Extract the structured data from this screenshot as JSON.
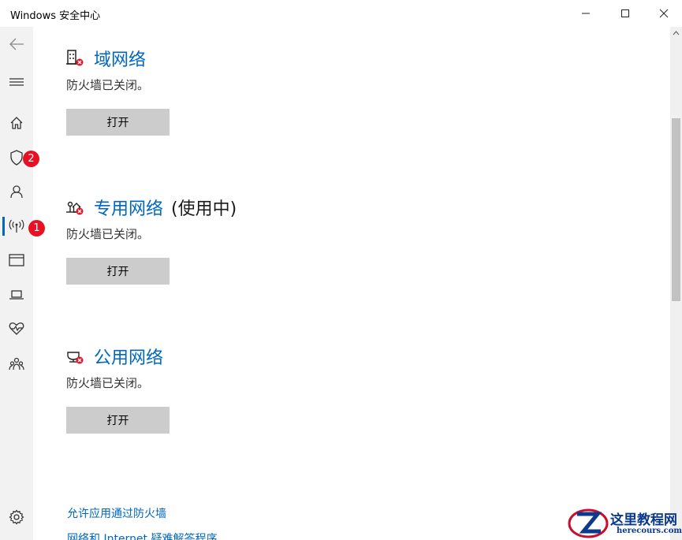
{
  "window": {
    "title": "Windows 安全中心",
    "minimize_icon": "minimize-icon",
    "maximize_icon": "maximize-icon",
    "close_icon": "close-icon"
  },
  "sidebar": {
    "items": [
      {
        "icon": "back-arrow-icon"
      },
      {
        "icon": "hamburger-menu-icon"
      },
      {
        "icon": "home-icon"
      },
      {
        "icon": "shield-icon",
        "badge": "2"
      },
      {
        "icon": "account-icon"
      },
      {
        "icon": "network-antenna-icon",
        "badge": "1",
        "active": true
      },
      {
        "icon": "app-browser-icon"
      },
      {
        "icon": "device-laptop-icon"
      },
      {
        "icon": "health-heart-icon"
      },
      {
        "icon": "family-icon"
      },
      {
        "icon": "settings-gear-icon"
      }
    ]
  },
  "sections": [
    {
      "title": "域网络",
      "suffix": "",
      "status": "防火墙已关闭。",
      "button": "打开",
      "icon": "domain-network-warning-icon"
    },
    {
      "title": "专用网络",
      "suffix": "(使用中)",
      "status": "防火墙已关闭。",
      "button": "打开",
      "icon": "private-network-warning-icon"
    },
    {
      "title": "公用网络",
      "suffix": "",
      "status": "防火墙已关闭。",
      "button": "打开",
      "icon": "public-network-warning-icon"
    }
  ],
  "links": [
    "允许应用通过防火墙",
    "网络和 Internet 疑难解答程序"
  ],
  "watermark": {
    "text": "这里教程网",
    "sub": "herecours.com"
  },
  "colors": {
    "accent": "#0067c0",
    "badge": "#e81123",
    "button_bg": "#cccccc",
    "sidebar_bg": "#f2f2f2"
  }
}
